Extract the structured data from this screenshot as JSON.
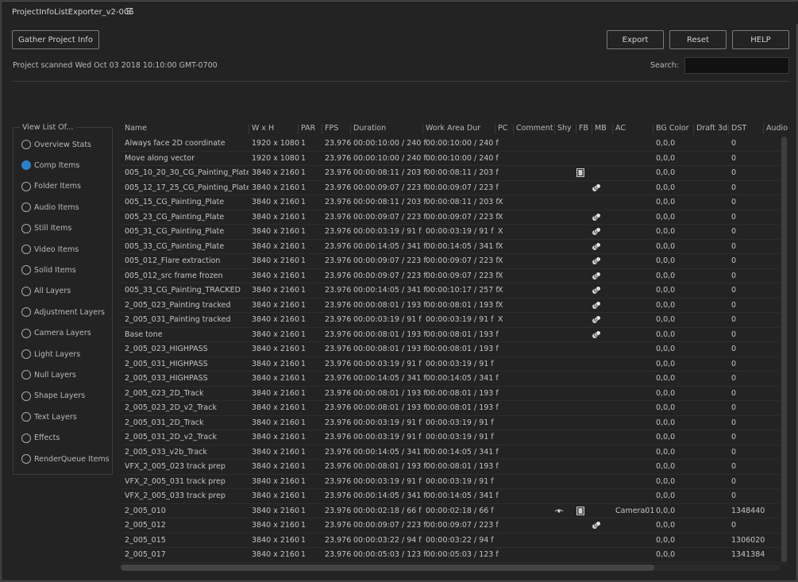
{
  "window": {
    "title": "ProjectInfoListExporter_v2-006",
    "menu_icon": "hamburger-menu-icon"
  },
  "toolbar": {
    "gather_label": "Gather Project Info",
    "export_label": "Export",
    "reset_label": "Reset",
    "help_label": "HELP"
  },
  "status": {
    "scan_text": "Project scanned Wed Oct 03 2018 10:10:00 GMT-0700"
  },
  "search": {
    "label": "Search:",
    "value": "",
    "placeholder": ""
  },
  "view_list": {
    "legend": "View List Of...",
    "items": [
      {
        "label": "Overview Stats",
        "selected": false
      },
      {
        "label": "Comp Items",
        "selected": true
      },
      {
        "label": "Folder Items",
        "selected": false
      },
      {
        "label": "Audio Items",
        "selected": false
      },
      {
        "label": "Still Items",
        "selected": false
      },
      {
        "label": "Video Items",
        "selected": false
      },
      {
        "label": "Solid Items",
        "selected": false
      },
      {
        "label": "All Layers",
        "selected": false
      },
      {
        "label": "Adjustment Layers",
        "selected": false
      },
      {
        "label": "Camera Layers",
        "selected": false
      },
      {
        "label": "Light Layers",
        "selected": false
      },
      {
        "label": "Null Layers",
        "selected": false
      },
      {
        "label": "Shape Layers",
        "selected": false
      },
      {
        "label": "Text Layers",
        "selected": false
      },
      {
        "label": "Effects",
        "selected": false
      },
      {
        "label": "RenderQueue Items",
        "selected": false
      }
    ]
  },
  "table": {
    "columns": [
      "Name",
      "W x H",
      "PAR",
      "FPS",
      "Duration",
      "Work Area Dur",
      "PC",
      "Comment",
      "Shy",
      "FB",
      "MB",
      "AC",
      "BG Color",
      "Draft 3d",
      "DST",
      "Audio"
    ],
    "rows": [
      {
        "name": "Always face 2D coordinate",
        "wh": "1920 x 1080",
        "par": "1",
        "fps": "23.976",
        "dur": "00:00:10:00 / 240 f",
        "wad": "00:00:10:00 / 240 f",
        "pc": "",
        "shy": "",
        "fb": "",
        "mb": "",
        "ac": "",
        "bg": "0,0,0",
        "dst": "0"
      },
      {
        "name": "Move along vector",
        "wh": "1920 x 1080",
        "par": "1",
        "fps": "23.976",
        "dur": "00:00:10:00 / 240 f",
        "wad": "00:00:10:00 / 240 f",
        "pc": "",
        "shy": "",
        "fb": "",
        "mb": "",
        "ac": "",
        "bg": "0,0,0",
        "dst": "0"
      },
      {
        "name": "005_10_20_30_CG_Painting_Plate",
        "wh": "3840 x 2160",
        "par": "1",
        "fps": "23.976",
        "dur": "00:00:08:11 / 203 f",
        "wad": "00:00:08:11 / 203 f",
        "pc": "",
        "shy": "",
        "fb": "film-strip-icon",
        "mb": "",
        "ac": "",
        "bg": "0,0,0",
        "dst": "0"
      },
      {
        "name": "005_12_17_25_CG_Painting_Plate",
        "wh": "3840 x 2160",
        "par": "1",
        "fps": "23.976",
        "dur": "00:00:09:07 / 223 f",
        "wad": "00:00:09:07 / 223 f",
        "pc": "",
        "shy": "",
        "fb": "",
        "mb": "motion-blur-icon",
        "ac": "",
        "bg": "0,0,0",
        "dst": "0"
      },
      {
        "name": "005_15_CG_Painting_Plate",
        "wh": "3840 x 2160",
        "par": "1",
        "fps": "23.976",
        "dur": "00:00:08:11 / 203 f",
        "wad": "00:00:08:11 / 203 f",
        "pc": "X",
        "shy": "",
        "fb": "",
        "mb": "",
        "ac": "",
        "bg": "0,0,0",
        "dst": "0"
      },
      {
        "name": "005_23_CG_Painting_Plate",
        "wh": "3840 x 2160",
        "par": "1",
        "fps": "23.976",
        "dur": "00:00:09:07 / 223 f",
        "wad": "00:00:09:07 / 223 f",
        "pc": "X",
        "shy": "",
        "fb": "",
        "mb": "motion-blur-icon",
        "ac": "",
        "bg": "0,0,0",
        "dst": "0"
      },
      {
        "name": "005_31_CG_Painting_Plate",
        "wh": "3840 x 2160",
        "par": "1",
        "fps": "23.976",
        "dur": "00:00:03:19 / 91 f",
        "wad": "00:00:03:19 / 91 f",
        "pc": "X",
        "shy": "",
        "fb": "",
        "mb": "motion-blur-icon",
        "ac": "",
        "bg": "0,0,0",
        "dst": "0"
      },
      {
        "name": "005_33_CG_Painting_Plate",
        "wh": "3840 x 2160",
        "par": "1",
        "fps": "23.976",
        "dur": "00:00:14:05 / 341 f",
        "wad": "00:00:14:05 / 341 f",
        "pc": "X",
        "shy": "",
        "fb": "",
        "mb": "motion-blur-icon",
        "ac": "",
        "bg": "0,0,0",
        "dst": "0"
      },
      {
        "name": "005_012_Flare extraction",
        "wh": "3840 x 2160",
        "par": "1",
        "fps": "23.976",
        "dur": "00:00:09:07 / 223 f",
        "wad": "00:00:09:07 / 223 f",
        "pc": "X",
        "shy": "",
        "fb": "",
        "mb": "motion-blur-icon",
        "ac": "",
        "bg": "0,0,0",
        "dst": "0"
      },
      {
        "name": "005_012_src frame frozen",
        "wh": "3840 x 2160",
        "par": "1",
        "fps": "23.976",
        "dur": "00:00:09:07 / 223 f",
        "wad": "00:00:09:07 / 223 f",
        "pc": "X",
        "shy": "",
        "fb": "",
        "mb": "motion-blur-icon",
        "ac": "",
        "bg": "0,0,0",
        "dst": "0"
      },
      {
        "name": "005_33_CG_Painting_TRACKED",
        "wh": "3840 x 2160",
        "par": "1",
        "fps": "23.976",
        "dur": "00:00:14:05 / 341 f",
        "wad": "00:00:10:17 / 257 f",
        "pc": "X",
        "shy": "",
        "fb": "",
        "mb": "motion-blur-icon",
        "ac": "",
        "bg": "0,0,0",
        "dst": "0"
      },
      {
        "name": "2_005_023_Painting tracked",
        "wh": "3840 x 2160",
        "par": "1",
        "fps": "23.976",
        "dur": "00:00:08:01 / 193 f",
        "wad": "00:00:08:01 / 193 f",
        "pc": "X",
        "shy": "",
        "fb": "",
        "mb": "motion-blur-icon",
        "ac": "",
        "bg": "0,0,0",
        "dst": "0"
      },
      {
        "name": "2_005_031_Painting tracked",
        "wh": "3840 x 2160",
        "par": "1",
        "fps": "23.976",
        "dur": "00:00:03:19 / 91 f",
        "wad": "00:00:03:19 / 91 f",
        "pc": "X",
        "shy": "",
        "fb": "",
        "mb": "motion-blur-icon",
        "ac": "",
        "bg": "0,0,0",
        "dst": "0"
      },
      {
        "name": "Base tone",
        "wh": "3840 x 2160",
        "par": "1",
        "fps": "23.976",
        "dur": "00:00:08:01 / 193 f",
        "wad": "00:00:08:01 / 193 f",
        "pc": "",
        "shy": "",
        "fb": "",
        "mb": "motion-blur-icon",
        "ac": "",
        "bg": "0,0,0",
        "dst": "0"
      },
      {
        "name": "2_005_023_HIGHPASS",
        "wh": "3840 x 2160",
        "par": "1",
        "fps": "23.976",
        "dur": "00:00:08:01 / 193 f",
        "wad": "00:00:08:01 / 193 f",
        "pc": "",
        "shy": "",
        "fb": "",
        "mb": "",
        "ac": "",
        "bg": "0,0,0",
        "dst": "0"
      },
      {
        "name": "2_005_031_HIGHPASS",
        "wh": "3840 x 2160",
        "par": "1",
        "fps": "23.976",
        "dur": "00:00:03:19 / 91 f",
        "wad": "00:00:03:19 / 91 f",
        "pc": "",
        "shy": "",
        "fb": "",
        "mb": "",
        "ac": "",
        "bg": "0,0,0",
        "dst": "0"
      },
      {
        "name": "2_005_033_HIGHPASS",
        "wh": "3840 x 2160",
        "par": "1",
        "fps": "23.976",
        "dur": "00:00:14:05 / 341 f",
        "wad": "00:00:14:05 / 341 f",
        "pc": "",
        "shy": "",
        "fb": "",
        "mb": "",
        "ac": "",
        "bg": "0,0,0",
        "dst": "0"
      },
      {
        "name": "2_005_023_2D_Track",
        "wh": "3840 x 2160",
        "par": "1",
        "fps": "23.976",
        "dur": "00:00:08:01 / 193 f",
        "wad": "00:00:08:01 / 193 f",
        "pc": "",
        "shy": "",
        "fb": "",
        "mb": "",
        "ac": "",
        "bg": "0,0,0",
        "dst": "0"
      },
      {
        "name": "2_005_023_2D_v2_Track",
        "wh": "3840 x 2160",
        "par": "1",
        "fps": "23.976",
        "dur": "00:00:08:01 / 193 f",
        "wad": "00:00:08:01 / 193 f",
        "pc": "",
        "shy": "",
        "fb": "",
        "mb": "",
        "ac": "",
        "bg": "0,0,0",
        "dst": "0"
      },
      {
        "name": "2_005_031_2D_Track",
        "wh": "3840 x 2160",
        "par": "1",
        "fps": "23.976",
        "dur": "00:00:03:19 / 91 f",
        "wad": "00:00:03:19 / 91 f",
        "pc": "",
        "shy": "",
        "fb": "",
        "mb": "",
        "ac": "",
        "bg": "0,0,0",
        "dst": "0"
      },
      {
        "name": "2_005_031_2D_v2_Track",
        "wh": "3840 x 2160",
        "par": "1",
        "fps": "23.976",
        "dur": "00:00:03:19 / 91 f",
        "wad": "00:00:03:19 / 91 f",
        "pc": "",
        "shy": "",
        "fb": "",
        "mb": "",
        "ac": "",
        "bg": "0,0,0",
        "dst": "0"
      },
      {
        "name": "2_005_033_v2b_Track",
        "wh": "3840 x 2160",
        "par": "1",
        "fps": "23.976",
        "dur": "00:00:14:05 / 341 f",
        "wad": "00:00:14:05 / 341 f",
        "pc": "",
        "shy": "",
        "fb": "",
        "mb": "",
        "ac": "",
        "bg": "0,0,0",
        "dst": "0"
      },
      {
        "name": "VFX_2_005_023 track prep",
        "wh": "3840 x 2160",
        "par": "1",
        "fps": "23.976",
        "dur": "00:00:08:01 / 193 f",
        "wad": "00:00:08:01 / 193 f",
        "pc": "",
        "shy": "",
        "fb": "",
        "mb": "",
        "ac": "",
        "bg": "0,0,0",
        "dst": "0"
      },
      {
        "name": "VFX_2_005_031 track prep",
        "wh": "3840 x 2160",
        "par": "1",
        "fps": "23.976",
        "dur": "00:00:03:19 / 91 f",
        "wad": "00:00:03:19 / 91 f",
        "pc": "",
        "shy": "",
        "fb": "",
        "mb": "",
        "ac": "",
        "bg": "0,0,0",
        "dst": "0"
      },
      {
        "name": "VFX_2_005_033 track prep",
        "wh": "3840 x 2160",
        "par": "1",
        "fps": "23.976",
        "dur": "00:00:14:05 / 341 f",
        "wad": "00:00:14:05 / 341 f",
        "pc": "",
        "shy": "",
        "fb": "",
        "mb": "",
        "ac": "",
        "bg": "0,0,0",
        "dst": "0"
      },
      {
        "name": "2_005_010",
        "wh": "3840 x 2160",
        "par": "1",
        "fps": "23.976",
        "dur": "00:00:02:18 / 66 f",
        "wad": "00:00:02:18 / 66 f",
        "pc": "",
        "shy": "shy-icon",
        "fb": "film-strip-icon",
        "mb": "",
        "ac": "Camera01",
        "bg": "0,0,0",
        "dst": "1348440"
      },
      {
        "name": "2_005_012",
        "wh": "3840 x 2160",
        "par": "1",
        "fps": "23.976",
        "dur": "00:00:09:07 / 223 f",
        "wad": "00:00:09:07 / 223 f",
        "pc": "",
        "shy": "",
        "fb": "",
        "mb": "motion-blur-icon",
        "ac": "",
        "bg": "0,0,0",
        "dst": "0"
      },
      {
        "name": "2_005_015",
        "wh": "3840 x 2160",
        "par": "1",
        "fps": "23.976",
        "dur": "00:00:03:22 / 94 f",
        "wad": "00:00:03:22 / 94 f",
        "pc": "",
        "shy": "",
        "fb": "",
        "mb": "",
        "ac": "",
        "bg": "0,0,0",
        "dst": "1306020"
      },
      {
        "name": "2_005_017",
        "wh": "3840 x 2160",
        "par": "1",
        "fps": "23.976",
        "dur": "00:00:05:03 / 123 f",
        "wad": "00:00:05:03 / 123 f",
        "pc": "",
        "shy": "",
        "fb": "",
        "mb": "",
        "ac": "",
        "bg": "0,0,0",
        "dst": "1341384"
      }
    ]
  },
  "colors": {
    "background": "#232323",
    "accent": "#2d7fc8",
    "text": "#c4c4c4",
    "border": "#7a7a7a"
  }
}
